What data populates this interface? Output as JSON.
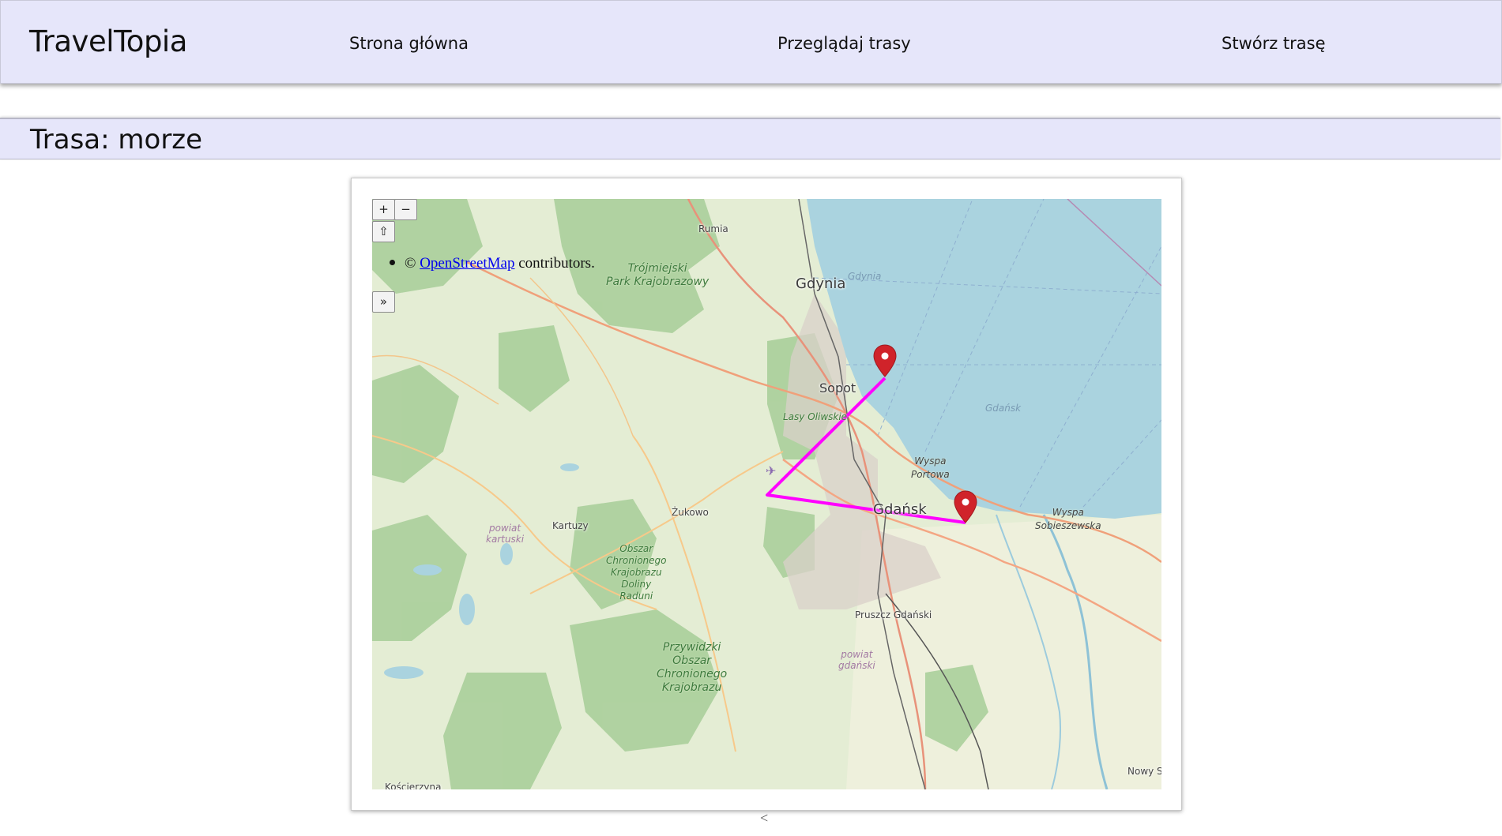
{
  "header": {
    "brand": "TravelTopia",
    "nav": {
      "home": "Strona główna",
      "browse": "Przeglądaj trasy",
      "create": "Stwórz trasę"
    }
  },
  "page": {
    "title": "Trasa: morze"
  },
  "map": {
    "controls": {
      "zoom_in": "+",
      "zoom_out": "−",
      "rotate": "⇧",
      "attribution_toggle": "»"
    },
    "attribution": {
      "prefix": "©",
      "link": "OpenStreetMap",
      "suffix": "contributors."
    },
    "labels": {
      "rumia": "Rumia",
      "gdynia": "Gdynia",
      "gdynia_sea": "Gdynia",
      "sopot": "Sopot",
      "lasy": "Lasy Oliwskie",
      "gdansk": "Gdańsk",
      "gdansk_sea": "Gdańsk",
      "wyspa_portowa": "Wyspa\nPortowa",
      "wyspa_sob": "Wyspa\nSobieszewska",
      "zukowo": "Żukowo",
      "kartuzy": "Kartuzy",
      "powiat_kart": "powiat\nkartuski",
      "pruszcz": "Pruszcz Gdański",
      "powiat_gd": "powiat\ngdański",
      "trojmiejski": "Trójmiejski\nPark Krajobrazowy",
      "obszar_radunia": "Obszar\nChronionego\nKrajobrazu\nDoliny\nRaduni",
      "przywidzki": "Przywidzki\nObszar\nChronionego\nKrajobrazu",
      "koscierzyna": "Kościerzyna",
      "nowy": "Nowy S"
    },
    "route_color": "#ff00ff",
    "marker_color": "#d0232a",
    "water_color": "#aad3df",
    "forest_color": "#add19e"
  },
  "pager": {
    "prev": "<"
  }
}
